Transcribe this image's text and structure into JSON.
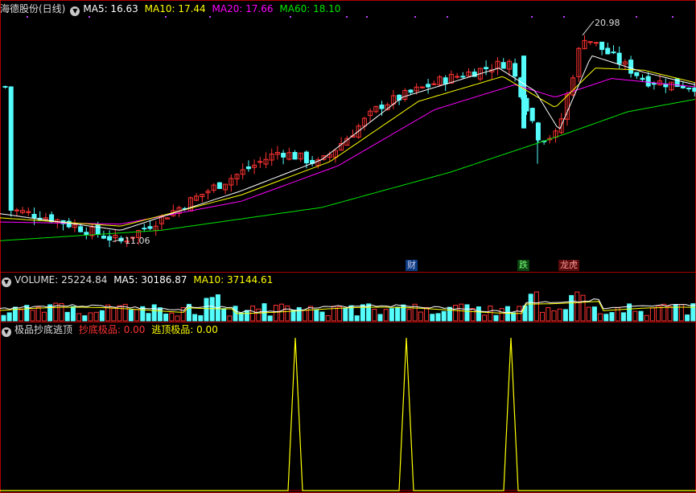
{
  "header": {
    "title": "海德股份(日线)",
    "ma5_label": "MA5: 16.63",
    "ma10_label": "MA10: 17.44",
    "ma20_label": "MA20: 17.66",
    "ma60_label": "MA60: 18.10"
  },
  "volume_header": {
    "title": "VOLUME: 25224.84",
    "ma5_label": "MA5: 30186.87",
    "ma10_label": "MA10: 37144.61"
  },
  "indicator_header": {
    "title": "极品抄底逃顶",
    "bottom_label": "抄底极品: 0.00",
    "top_label": "逃顶极品: 0.00"
  },
  "markers": {
    "cai": "财",
    "die": "跌",
    "bang": "龙虎"
  },
  "colors": {
    "up": "#ff3232",
    "down": "#54fcfc",
    "ma5": "#ffffff",
    "ma10": "#ffff00",
    "ma20": "#ff00ff",
    "ma60": "#00e600",
    "signal": "#ffff00",
    "grid": "#b00000"
  },
  "chart_data": [
    {
      "type": "candlestick",
      "title": "海德股份(日线)",
      "price_labels": {
        "high": "20.98",
        "low": "11.06"
      },
      "key_points": [
        {
          "x": 10,
          "y": 12.6
        },
        {
          "x": 60,
          "y": 12.2
        },
        {
          "x": 148,
          "y": 11.06
        },
        {
          "x": 260,
          "y": 13.6
        },
        {
          "x": 345,
          "y": 15.4
        },
        {
          "x": 395,
          "y": 14.8
        },
        {
          "x": 470,
          "y": 17.6
        },
        {
          "x": 545,
          "y": 18.8
        },
        {
          "x": 630,
          "y": 19.7
        },
        {
          "x": 668,
          "y": 16.0
        },
        {
          "x": 690,
          "y": 16.2
        },
        {
          "x": 722,
          "y": 20.98
        },
        {
          "x": 800,
          "y": 18.8
        },
        {
          "x": 864,
          "y": 18.5
        }
      ],
      "ma_points": {
        "ma5": [
          {
            "x": 0,
            "y": 12.4
          },
          {
            "x": 150,
            "y": 11.6
          },
          {
            "x": 300,
            "y": 13.5
          },
          {
            "x": 400,
            "y": 15.0
          },
          {
            "x": 500,
            "y": 18.0
          },
          {
            "x": 620,
            "y": 19.4
          },
          {
            "x": 665,
            "y": 18.3
          },
          {
            "x": 695,
            "y": 16.4
          },
          {
            "x": 735,
            "y": 20.0
          },
          {
            "x": 800,
            "y": 19.2
          },
          {
            "x": 864,
            "y": 18.6
          }
        ],
        "ma10": [
          {
            "x": 0,
            "y": 12.2
          },
          {
            "x": 150,
            "y": 11.8
          },
          {
            "x": 300,
            "y": 13.3
          },
          {
            "x": 410,
            "y": 14.9
          },
          {
            "x": 520,
            "y": 17.8
          },
          {
            "x": 625,
            "y": 19.0
          },
          {
            "x": 690,
            "y": 17.5
          },
          {
            "x": 740,
            "y": 19.4
          },
          {
            "x": 800,
            "y": 19.3
          },
          {
            "x": 864,
            "y": 18.7
          }
        ],
        "ma20": [
          {
            "x": 0,
            "y": 12.0
          },
          {
            "x": 150,
            "y": 11.9
          },
          {
            "x": 300,
            "y": 13.0
          },
          {
            "x": 420,
            "y": 14.7
          },
          {
            "x": 540,
            "y": 17.4
          },
          {
            "x": 640,
            "y": 18.6
          },
          {
            "x": 690,
            "y": 18.0
          },
          {
            "x": 760,
            "y": 18.9
          },
          {
            "x": 864,
            "y": 18.5
          }
        ],
        "ma60": [
          {
            "x": 0,
            "y": 11.1
          },
          {
            "x": 200,
            "y": 11.6
          },
          {
            "x": 400,
            "y": 12.7
          },
          {
            "x": 560,
            "y": 14.4
          },
          {
            "x": 700,
            "y": 16.2
          },
          {
            "x": 780,
            "y": 17.3
          },
          {
            "x": 864,
            "y": 17.9
          }
        ]
      },
      "ylim": [
        10.3,
        21.9
      ]
    },
    {
      "type": "bar",
      "title": "VOLUME: 25224.84",
      "ylim": [
        0,
        100
      ]
    },
    {
      "type": "line",
      "title": "极品抄底逃顶",
      "signal_spikes": [
        367,
        505,
        635
      ],
      "ylim": [
        0,
        1
      ]
    }
  ]
}
